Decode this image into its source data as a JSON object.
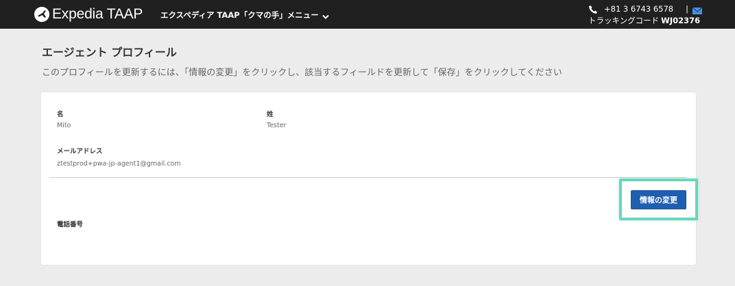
{
  "header": {
    "logo_text": "Expedia TAAP",
    "menu_label": "エクスペディア TAAP「クマの手」メニュー",
    "phone": "+81 3 6743 6578",
    "separator": "|",
    "tracking_label": "トラッキングコード",
    "tracking_code": "WJ02376",
    "icons": [
      "expedia-logo-icon",
      "chevron-down-icon",
      "phone-icon",
      "mail-icon"
    ]
  },
  "page": {
    "title": "エージェント プロフィール",
    "description": "このプロフィールを更新するには、「情報の変更」をクリックし、該当するフィールドを更新して「保存」をクリックしてください"
  },
  "profile": {
    "first_name_label": "名",
    "first_name_value": "Mito",
    "last_name_label": "姓",
    "last_name_value": "Tester",
    "email_label": "メールアドレス",
    "email_value": "ztestprod+pwa-jp-agent1@gmail.com",
    "phone_label": "電話番号",
    "edit_button_label": "情報の変更"
  },
  "colors": {
    "topbar": "#202020",
    "page_background": "#ececec",
    "button": "#1f5fb2",
    "highlight": "#6ad5bd",
    "mail_icon": "#4a90e2"
  }
}
